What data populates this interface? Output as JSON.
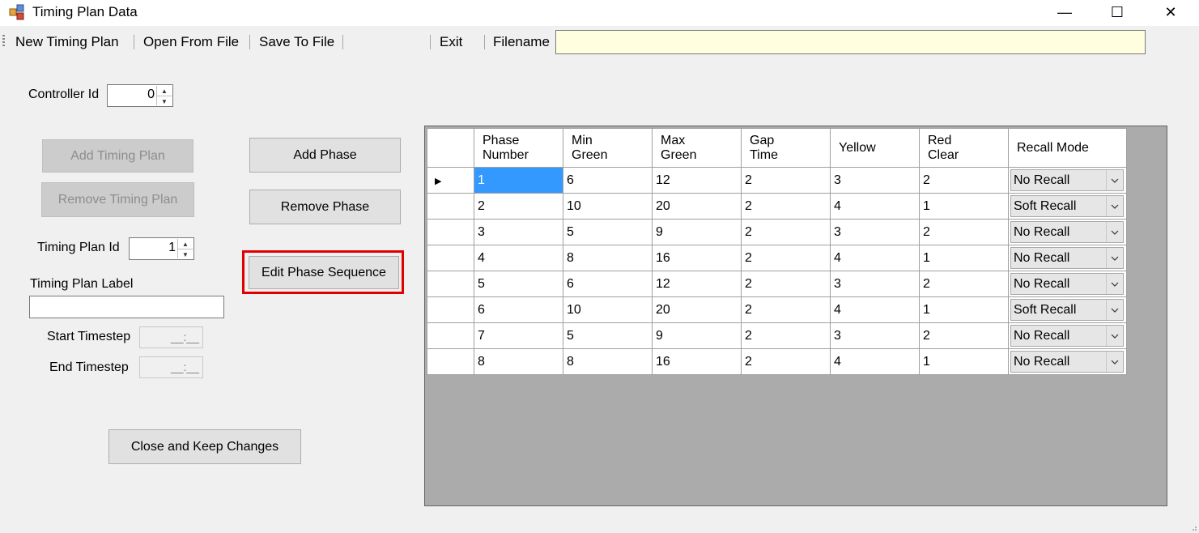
{
  "window": {
    "title": "Timing Plan Data",
    "minimize": "—",
    "maximize": "☐",
    "close": "✕"
  },
  "toolbar": {
    "new_timing_plan": "New Timing Plan",
    "open_from_file": "Open From File",
    "save_to_file": "Save To File",
    "exit": "Exit",
    "filename_label": "Filename",
    "filename_value": ""
  },
  "form": {
    "controller_id_label": "Controller Id",
    "controller_id_value": "0",
    "add_timing_plan": "Add Timing Plan",
    "remove_timing_plan": "Remove Timing Plan",
    "timing_plan_id_label": "Timing Plan Id",
    "timing_plan_id_value": "1",
    "timing_plan_label_label": "Timing Plan Label",
    "timing_plan_label_value": "",
    "start_timestep_label": "Start Timestep",
    "start_timestep_value": "__:__",
    "end_timestep_label": "End Timestep",
    "end_timestep_value": "__:__",
    "add_phase": "Add Phase",
    "remove_phase": "Remove Phase",
    "edit_phase_sequence": "Edit Phase Sequence",
    "close_keep_changes": "Close and Keep Changes"
  },
  "grid": {
    "columns": [
      [
        "Phase",
        "Number"
      ],
      [
        "Min",
        "Green"
      ],
      [
        "Max",
        "Green"
      ],
      [
        "Gap",
        "Time"
      ],
      [
        "Yellow",
        ""
      ],
      [
        "Red",
        "Clear"
      ],
      [
        "Recall Mode",
        ""
      ]
    ],
    "current_row_marker": "▶",
    "rows": [
      [
        "1",
        "6",
        "12",
        "2",
        "3",
        "2",
        "No Recall"
      ],
      [
        "2",
        "10",
        "20",
        "2",
        "4",
        "1",
        "Soft Recall"
      ],
      [
        "3",
        "5",
        "9",
        "2",
        "3",
        "2",
        "No Recall"
      ],
      [
        "4",
        "8",
        "16",
        "2",
        "4",
        "1",
        "No Recall"
      ],
      [
        "5",
        "6",
        "12",
        "2",
        "3",
        "2",
        "No Recall"
      ],
      [
        "6",
        "10",
        "20",
        "2",
        "4",
        "1",
        "Soft Recall"
      ],
      [
        "7",
        "5",
        "9",
        "2",
        "3",
        "2",
        "No Recall"
      ],
      [
        "8",
        "8",
        "16",
        "2",
        "4",
        "1",
        "No Recall"
      ]
    ]
  },
  "colors": {
    "selection": "#3399ff",
    "highlight_box": "#e00000",
    "filename_bg": "#ffffe0",
    "grid_bg": "#ababab"
  }
}
